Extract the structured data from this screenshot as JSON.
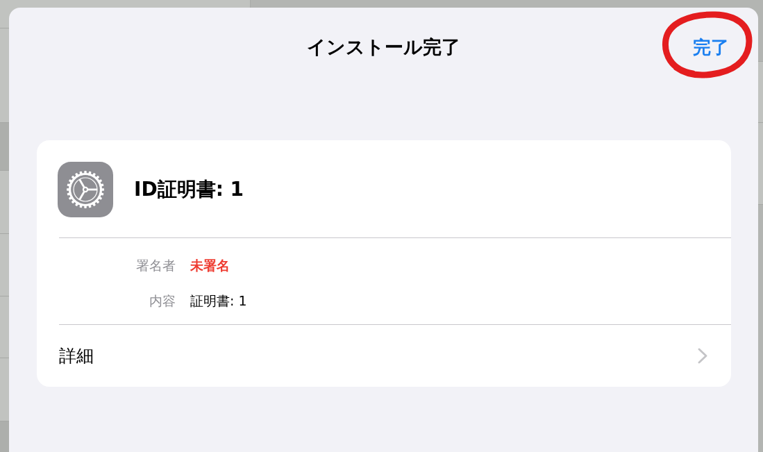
{
  "sheet": {
    "title": "インストール完了",
    "done_button": "完了"
  },
  "profile": {
    "name": "ID証明書: 1"
  },
  "details": [
    {
      "label": "署名者",
      "value": "未署名",
      "warning": true
    },
    {
      "label": "内容",
      "value": "証明書: 1",
      "warning": false
    }
  ],
  "more_row": {
    "label": "詳細"
  }
}
